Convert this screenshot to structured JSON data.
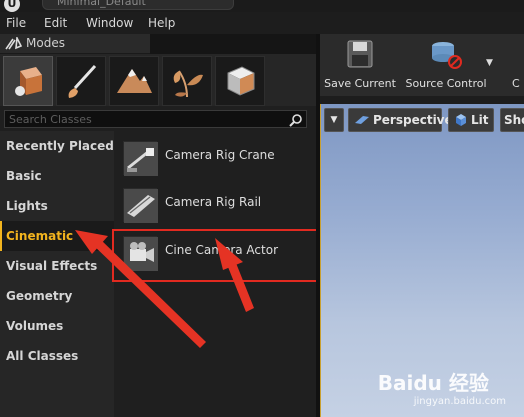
{
  "window": {
    "document_tab": "Minimal_Default",
    "logo": "U"
  },
  "menu": {
    "items": [
      "File",
      "Edit",
      "Window",
      "Help"
    ]
  },
  "modes_panel": {
    "title": "Modes",
    "mode_icons": [
      "place-mode-icon",
      "paint-mode-icon",
      "landscape-mode-icon",
      "foliage-mode-icon",
      "geometry-mode-icon"
    ],
    "search_placeholder": "Search Classes",
    "categories": [
      "Recently Placed",
      "Basic",
      "Lights",
      "Cinematic",
      "Visual Effects",
      "Geometry",
      "Volumes",
      "All Classes"
    ],
    "selected_category": "Cinematic",
    "assets": [
      "Camera Rig Crane",
      "Camera Rig Rail",
      "Cine Camera Actor"
    ]
  },
  "toolbar": {
    "save_current": "Save Current",
    "source_control": "Source Control",
    "partial_button": "C"
  },
  "viewport": {
    "perspective": "Perspective",
    "lit": "Lit",
    "show": "Sho"
  },
  "watermark": {
    "brand": "Baidu 经验",
    "url": "jingyan.baidu.com"
  },
  "colors": {
    "accent": "#f2b41e",
    "highlight": "#e22a20"
  }
}
